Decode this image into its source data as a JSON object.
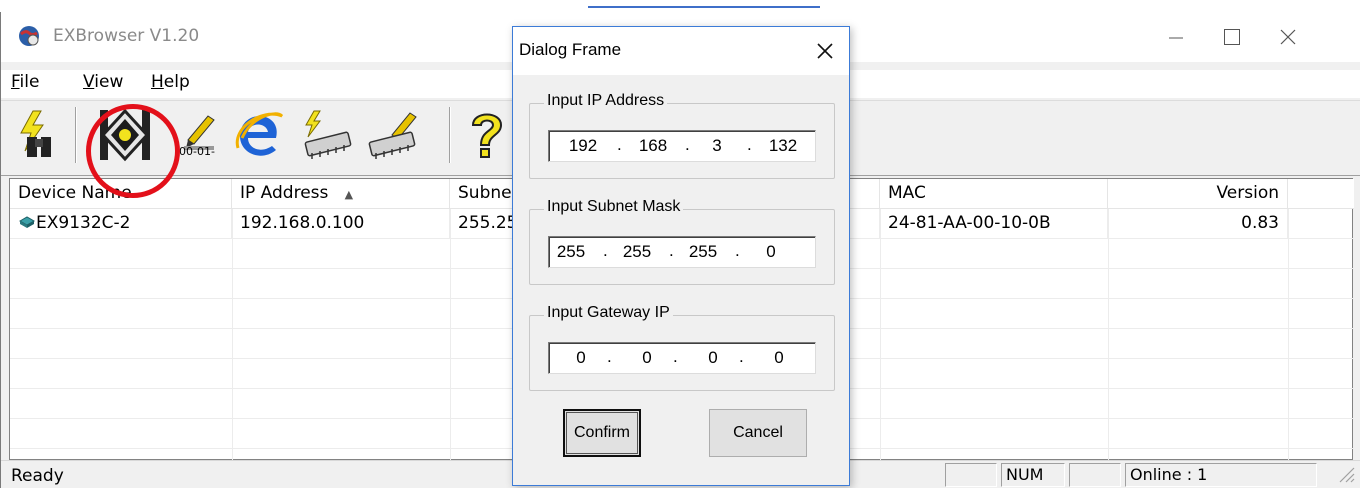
{
  "window": {
    "title": "EXBrowser V1.20"
  },
  "menu": [
    {
      "label": "File",
      "accel": "F",
      "rest": "ile"
    },
    {
      "label": "View",
      "accel": "V",
      "rest": "iew"
    },
    {
      "label": "Help",
      "accel": "H",
      "rest": "elp"
    }
  ],
  "toolbar": {
    "icons": [
      "search-device-icon",
      "set-ip-icon",
      "set-mac-icon",
      "web-browser-icon",
      "firmware-upgrade-icon",
      "edit-device-icon",
      "help-icon"
    ],
    "mac_snippet": "00-01-"
  },
  "list": {
    "columns": [
      "Device Name",
      "IP Address",
      "Subne",
      "MAC",
      "Version"
    ],
    "sort_arrow": "▲",
    "rows": [
      {
        "device_name": "EX9132C-2",
        "ip_address": "192.168.0.100",
        "subnet": "255.25",
        "mac": "24-81-AA-00-10-0B",
        "version": "0.83"
      }
    ]
  },
  "status": {
    "text": "Ready",
    "num": "NUM",
    "online": "Online : 1"
  },
  "dialog": {
    "title": "Dialog Frame",
    "ip_group": {
      "label": "Input IP Address",
      "octets": [
        "192",
        "168",
        "3",
        "132"
      ]
    },
    "mask_group": {
      "label": "Input Subnet Mask",
      "octets": [
        "255",
        "255",
        "255",
        "0"
      ]
    },
    "gateway_group": {
      "label": "Input Gateway IP",
      "octets": [
        "0",
        "0",
        "0",
        "0"
      ]
    },
    "confirm_label": "Confirm",
    "cancel_label": "Cancel",
    "separator": "."
  },
  "colors": {
    "highlight_ring": "#e3101a",
    "dialog_border": "#3c7bd7"
  }
}
